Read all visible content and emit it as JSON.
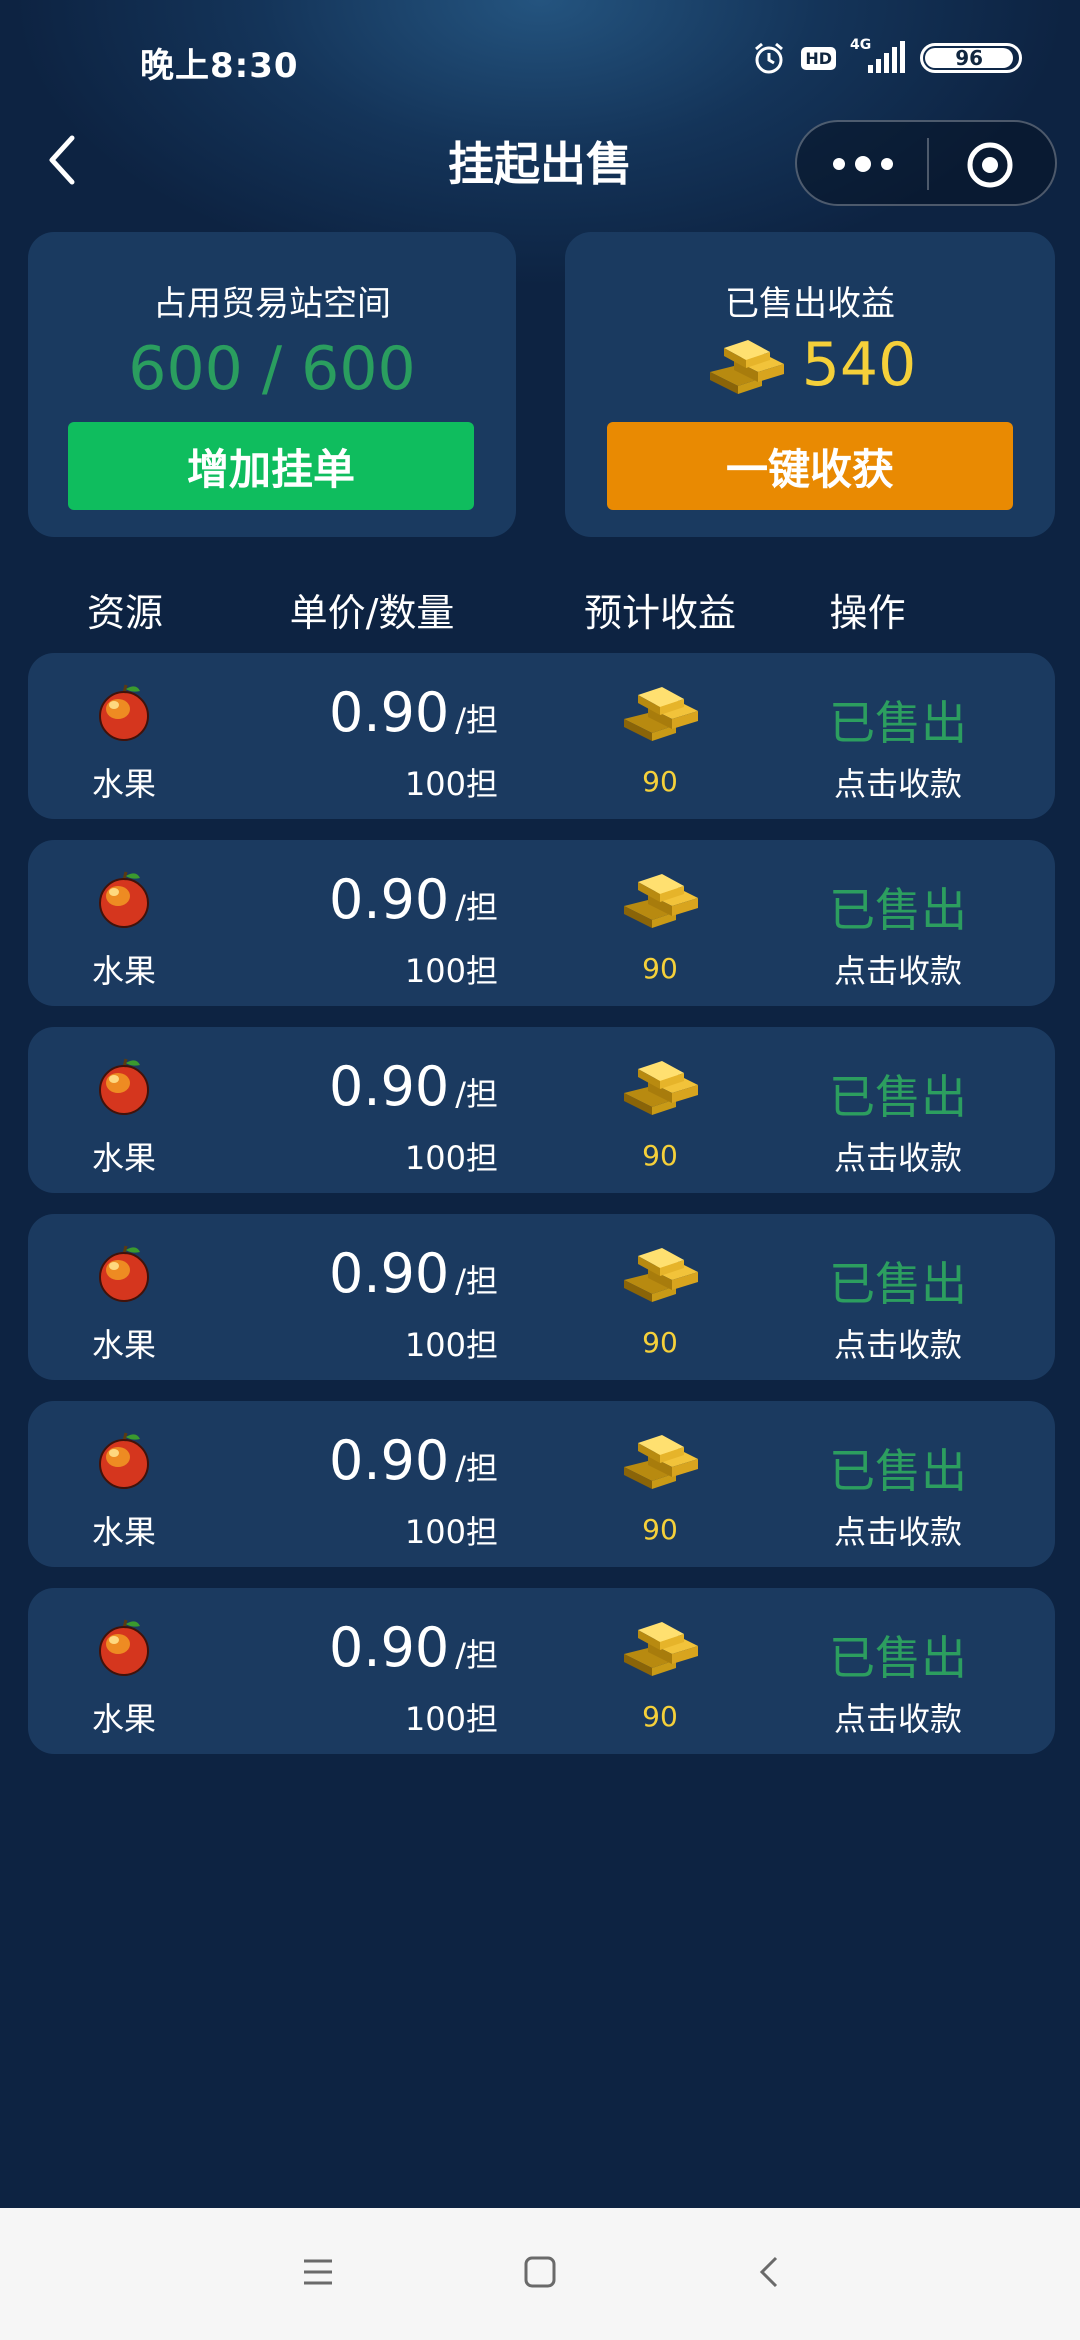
{
  "status_bar": {
    "time": "晚上8:30",
    "hd": "HD",
    "network": "4G",
    "battery": "96"
  },
  "nav": {
    "title": "挂起出售"
  },
  "space_card": {
    "title": "占用贸易站空间",
    "value": "600 / 600",
    "button": "增加挂单"
  },
  "income_card": {
    "title": "已售出收益",
    "value": "540",
    "button": "一键收获"
  },
  "columns": [
    "资源",
    "单价/数量",
    "预计收益",
    "操作"
  ],
  "rows": [
    {
      "resource": "水果",
      "price": "0.90",
      "unit": "/担",
      "quantity": "100担",
      "income": "90",
      "status": "已售出",
      "action": "点击收款"
    },
    {
      "resource": "水果",
      "price": "0.90",
      "unit": "/担",
      "quantity": "100担",
      "income": "90",
      "status": "已售出",
      "action": "点击收款"
    },
    {
      "resource": "水果",
      "price": "0.90",
      "unit": "/担",
      "quantity": "100担",
      "income": "90",
      "status": "已售出",
      "action": "点击收款"
    },
    {
      "resource": "水果",
      "price": "0.90",
      "unit": "/担",
      "quantity": "100担",
      "income": "90",
      "status": "已售出",
      "action": "点击收款"
    },
    {
      "resource": "水果",
      "price": "0.90",
      "unit": "/担",
      "quantity": "100担",
      "income": "90",
      "status": "已售出",
      "action": "点击收款"
    },
    {
      "resource": "水果",
      "price": "0.90",
      "unit": "/担",
      "quantity": "100担",
      "income": "90",
      "status": "已售出",
      "action": "点击收款"
    }
  ],
  "colors": {
    "green_text": "#2c9e5f",
    "gold_text": "#f5d03a",
    "green_button": "#0fbd5e",
    "orange_button": "#e98a02",
    "card_bg": "#1b3a60"
  }
}
